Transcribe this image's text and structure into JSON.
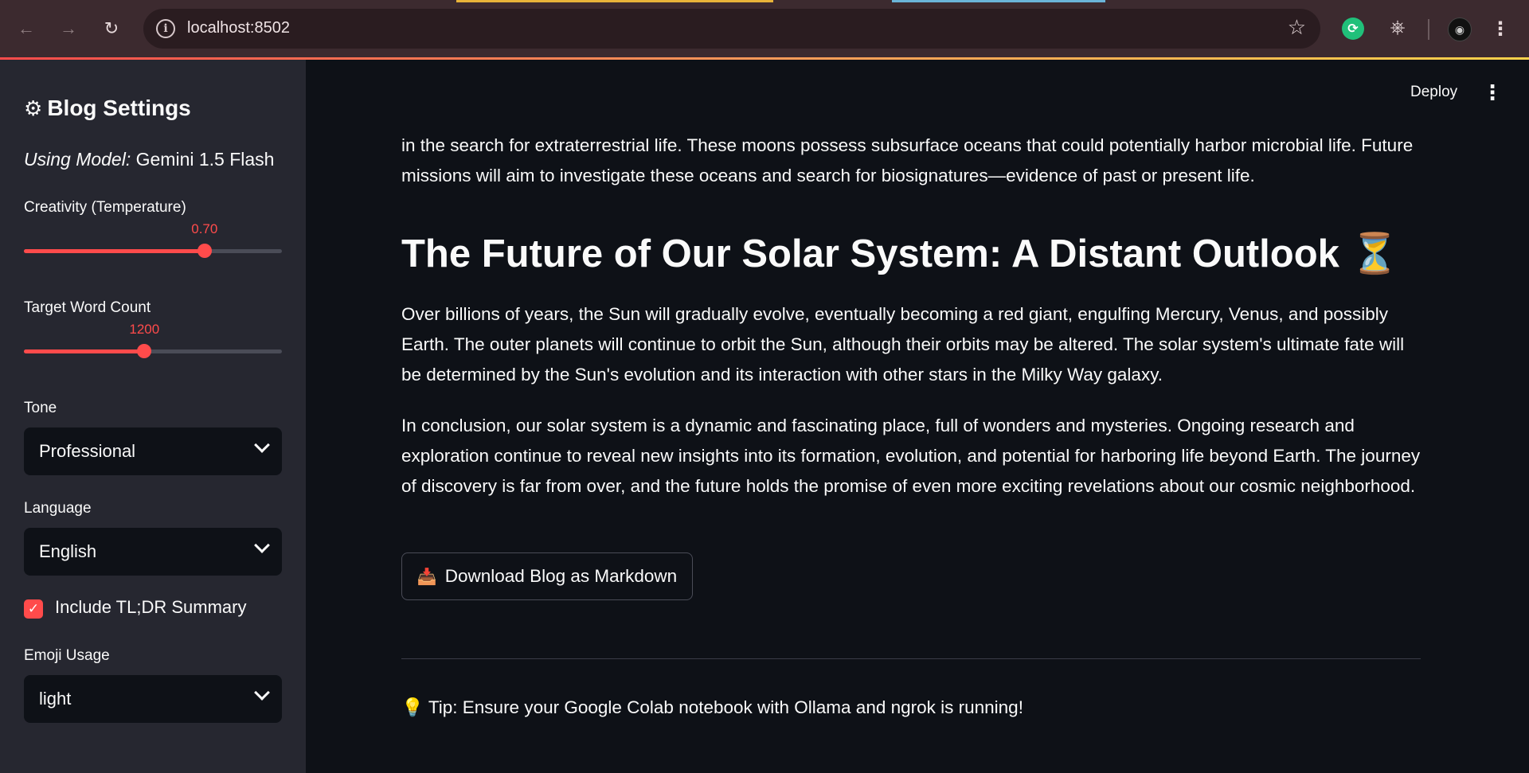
{
  "browser": {
    "url": "localhost:8502"
  },
  "sidebar": {
    "title": "Blog Settings",
    "model_prefix": "Using Model:",
    "model_name": "Gemini 1.5 Flash",
    "temperature": {
      "label": "Creativity (Temperature)",
      "value": "0.70",
      "fraction": 0.7
    },
    "word_count": {
      "label": "Target Word Count",
      "value": "1200",
      "fraction": 0.467
    },
    "tone": {
      "label": "Tone",
      "selected": "Professional"
    },
    "language": {
      "label": "Language",
      "selected": "English"
    },
    "tldr": {
      "label": "Include TL;DR Summary",
      "checked": true
    },
    "emoji": {
      "label": "Emoji Usage",
      "selected": "light"
    }
  },
  "header": {
    "deploy_label": "Deploy"
  },
  "main": {
    "para1": "in the search for extraterrestrial life. These moons possess subsurface oceans that could potentially harbor microbial life. Future missions will aim to investigate these oceans and search for biosignatures—evidence of past or present life.",
    "heading": "The Future of Our Solar System: A Distant Outlook ⏳",
    "para2": "Over billions of years, the Sun will gradually evolve, eventually becoming a red giant, engulfing Mercury, Venus, and possibly Earth. The outer planets will continue to orbit the Sun, although their orbits may be altered. The solar system's ultimate fate will be determined by the Sun's evolution and its interaction with other stars in the Milky Way galaxy.",
    "para3": "In conclusion, our solar system is a dynamic and fascinating place, full of wonders and mysteries. Ongoing research and exploration continue to reveal new insights into its formation, evolution, and potential for harboring life beyond Earth. The journey of discovery is far from over, and the future holds the promise of even more exciting revelations about our cosmic neighborhood.",
    "download_label": "Download Blog as Markdown",
    "tip": "💡 Tip: Ensure your Google Colab notebook with Ollama and ngrok is running!"
  },
  "colors": {
    "accent": "#ff4b4b",
    "sidebar_bg": "#262730",
    "main_bg": "#0e1117"
  }
}
